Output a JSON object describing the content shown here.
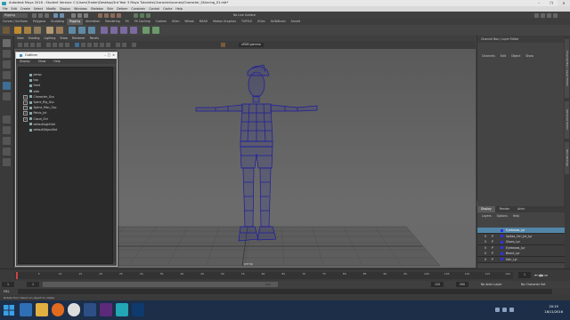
{
  "window": {
    "title": "Autodesk Maya 2016 - Student Version: C:\\Users\\Trader\\Desktop\\3rd Year 3 Maya Tutorials\\Character\\scenes\\Character_Skinning_01.mb*"
  },
  "menubar": [
    "File",
    "Edit",
    "Create",
    "Select",
    "Modify",
    "Display",
    "Windows",
    "Skeleton",
    "Skin",
    "Deform",
    "Constrain",
    "Control",
    "Cache",
    "Help"
  ],
  "status_line": {
    "mode": "Rigging",
    "live_surface": "No Live Surface"
  },
  "shelf_tabs": [
    "Curves / Surfaces",
    "Polygons",
    "Sculpting",
    "Rigging",
    "Animation",
    "Rendering",
    "FX",
    "FX Caching",
    "Custom",
    "XGen",
    "Bifrost",
    "MASH",
    "Motion Graphics",
    "TURTLE",
    "XGen",
    "GoToBrush",
    "Arnold"
  ],
  "shelf_active": "Rigging",
  "panel_menu": [
    "View",
    "Shading",
    "Lighting",
    "Show",
    "Renderer",
    "Panels"
  ],
  "viewport": {
    "color_space": "sRGB gamma",
    "camera_label": "persp"
  },
  "outliner": {
    "title": "Outliner",
    "menu": [
      "Display",
      "Show",
      "Help"
    ],
    "items": [
      {
        "label": "persp",
        "expandable": false
      },
      {
        "label": "top",
        "expandable": false
      },
      {
        "label": "front",
        "expandable": false
      },
      {
        "label": "side",
        "expandable": false
      },
      {
        "label": "Character_Grp",
        "expandable": true
      },
      {
        "label": "Spine_Rig_Grp",
        "expandable": true
      },
      {
        "label": "Spline_Misc_Grp",
        "expandable": true
      },
      {
        "label": "Pelvis_Jnt",
        "expandable": true
      },
      {
        "label": "Cloud_Ctrl",
        "expandable": true
      },
      {
        "label": "defaultLightSet",
        "expandable": false
      },
      {
        "label": "defaultObjectSet",
        "expandable": false
      }
    ]
  },
  "channel_box": {
    "title": "Channel Box / Layer Editor",
    "menu": [
      "Channels",
      "Edit",
      "Object",
      "Show"
    ]
  },
  "side_tabs": [
    "Channel Box / Layer Editor",
    "Attribute Editor",
    "Tool Settings"
  ],
  "layer_editor": {
    "tabs": [
      "Display",
      "Render",
      "Anim"
    ],
    "active_tab": "Display",
    "menu": [
      "Layers",
      "Options",
      "Help"
    ],
    "layers": [
      {
        "v": "",
        "p": "",
        "name": "Eyebrows_Lyr",
        "selected": true
      },
      {
        "v": "V",
        "p": "P",
        "name": "Spikes_Ctrl_Jnt_Lyr",
        "selected": false
      },
      {
        "v": "V",
        "p": "P",
        "name": "Shoes_Lyr",
        "selected": false
      },
      {
        "v": "V",
        "p": "P",
        "name": "Eyebrows_Lyr",
        "selected": false
      },
      {
        "v": "V",
        "p": "P",
        "name": "Beard_Lyr",
        "selected": false
      },
      {
        "v": "V",
        "p": "P",
        "name": "Hair_Lyr",
        "selected": false
      }
    ]
  },
  "timeline": {
    "ticks": [
      "5",
      "10",
      "15",
      "20",
      "25",
      "30",
      "35",
      "40",
      "45",
      "50",
      "55",
      "60",
      "65",
      "70",
      "75",
      "80",
      "85",
      "90",
      "95",
      "100",
      "105",
      "110",
      "115",
      "120"
    ],
    "current_frame": "1",
    "range_start": "1",
    "range_end": "120",
    "playback_start": "1",
    "playback_end": "120",
    "anim_end": "200",
    "anim_layer": "No Anim Layer",
    "char_set": "No Character Set"
  },
  "command_line": {
    "lang": "MEL"
  },
  "help_line": "Rotate Tool: Select an object to rotate.",
  "taskbar": {
    "time": "20:19",
    "date": "18/11/2016"
  },
  "colors": {
    "wireframe": "#1c1c9e",
    "selected_layer": "#5285a6",
    "taskbar": "#1c2e48"
  }
}
